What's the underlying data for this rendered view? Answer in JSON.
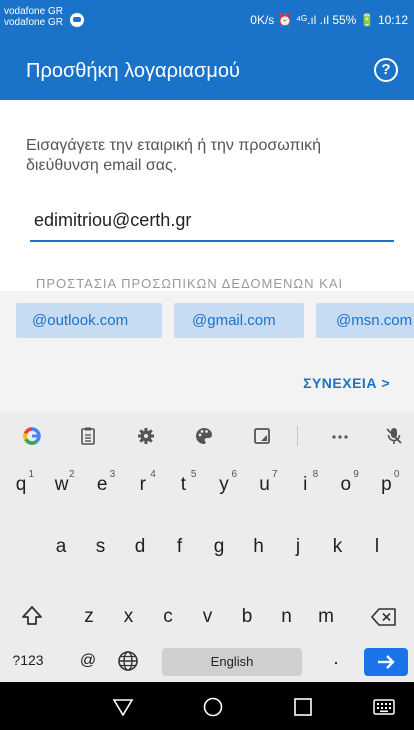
{
  "status_bar": {
    "carrier_1": "vodafone GR",
    "carrier_2": "vodafone GR",
    "right_text": "0K/s ⏰ ⁴ᴳ.ıl  .ıl 55% 🔋 10:12"
  },
  "app_bar": {
    "title": "Προσθήκη λογαριασμού",
    "help_icon": "help-circle-icon",
    "help_glyph": "?"
  },
  "content": {
    "instruction": "Εισαγάγετε την εταιρική ή την προσωπική διεύθυνση email σας.",
    "email_value": "edimitriou@certh.gr",
    "privacy_text": "ΠΡΟΣΤΑΣΙΑ ΠΡΟΣΩΠΙΚΩΝ ΔΕΔΟΜΕΝΩΝ ΚΑΙ",
    "domain_chips": [
      "@outlook.com",
      "@gmail.com",
      "@msn.com"
    ],
    "next_label": "ΣΥΝΕΧΕΙΑ >"
  },
  "keyboard": {
    "toolbar_icons": [
      "google-icon",
      "clipboard-icon",
      "settings-icon",
      "palette-icon",
      "resize-icon",
      "more-icon",
      "mic-off-icon"
    ],
    "row1": [
      "q",
      "w",
      "e",
      "r",
      "t",
      "y",
      "u",
      "i",
      "o",
      "p"
    ],
    "row1_hints": [
      "1",
      "2",
      "3",
      "4",
      "5",
      "6",
      "7",
      "8",
      "9",
      "0"
    ],
    "row2": [
      "a",
      "s",
      "d",
      "f",
      "g",
      "h",
      "j",
      "k",
      "l"
    ],
    "row3": [
      "z",
      "x",
      "c",
      "v",
      "b",
      "n",
      "m"
    ],
    "symbols_label": "?123",
    "at_label": "@",
    "space_label": "English",
    "period_label": "."
  },
  "colors": {
    "accent": "#1a73c8",
    "chip_bg": "#c7dbf3",
    "enter_key": "#1a73e8"
  }
}
